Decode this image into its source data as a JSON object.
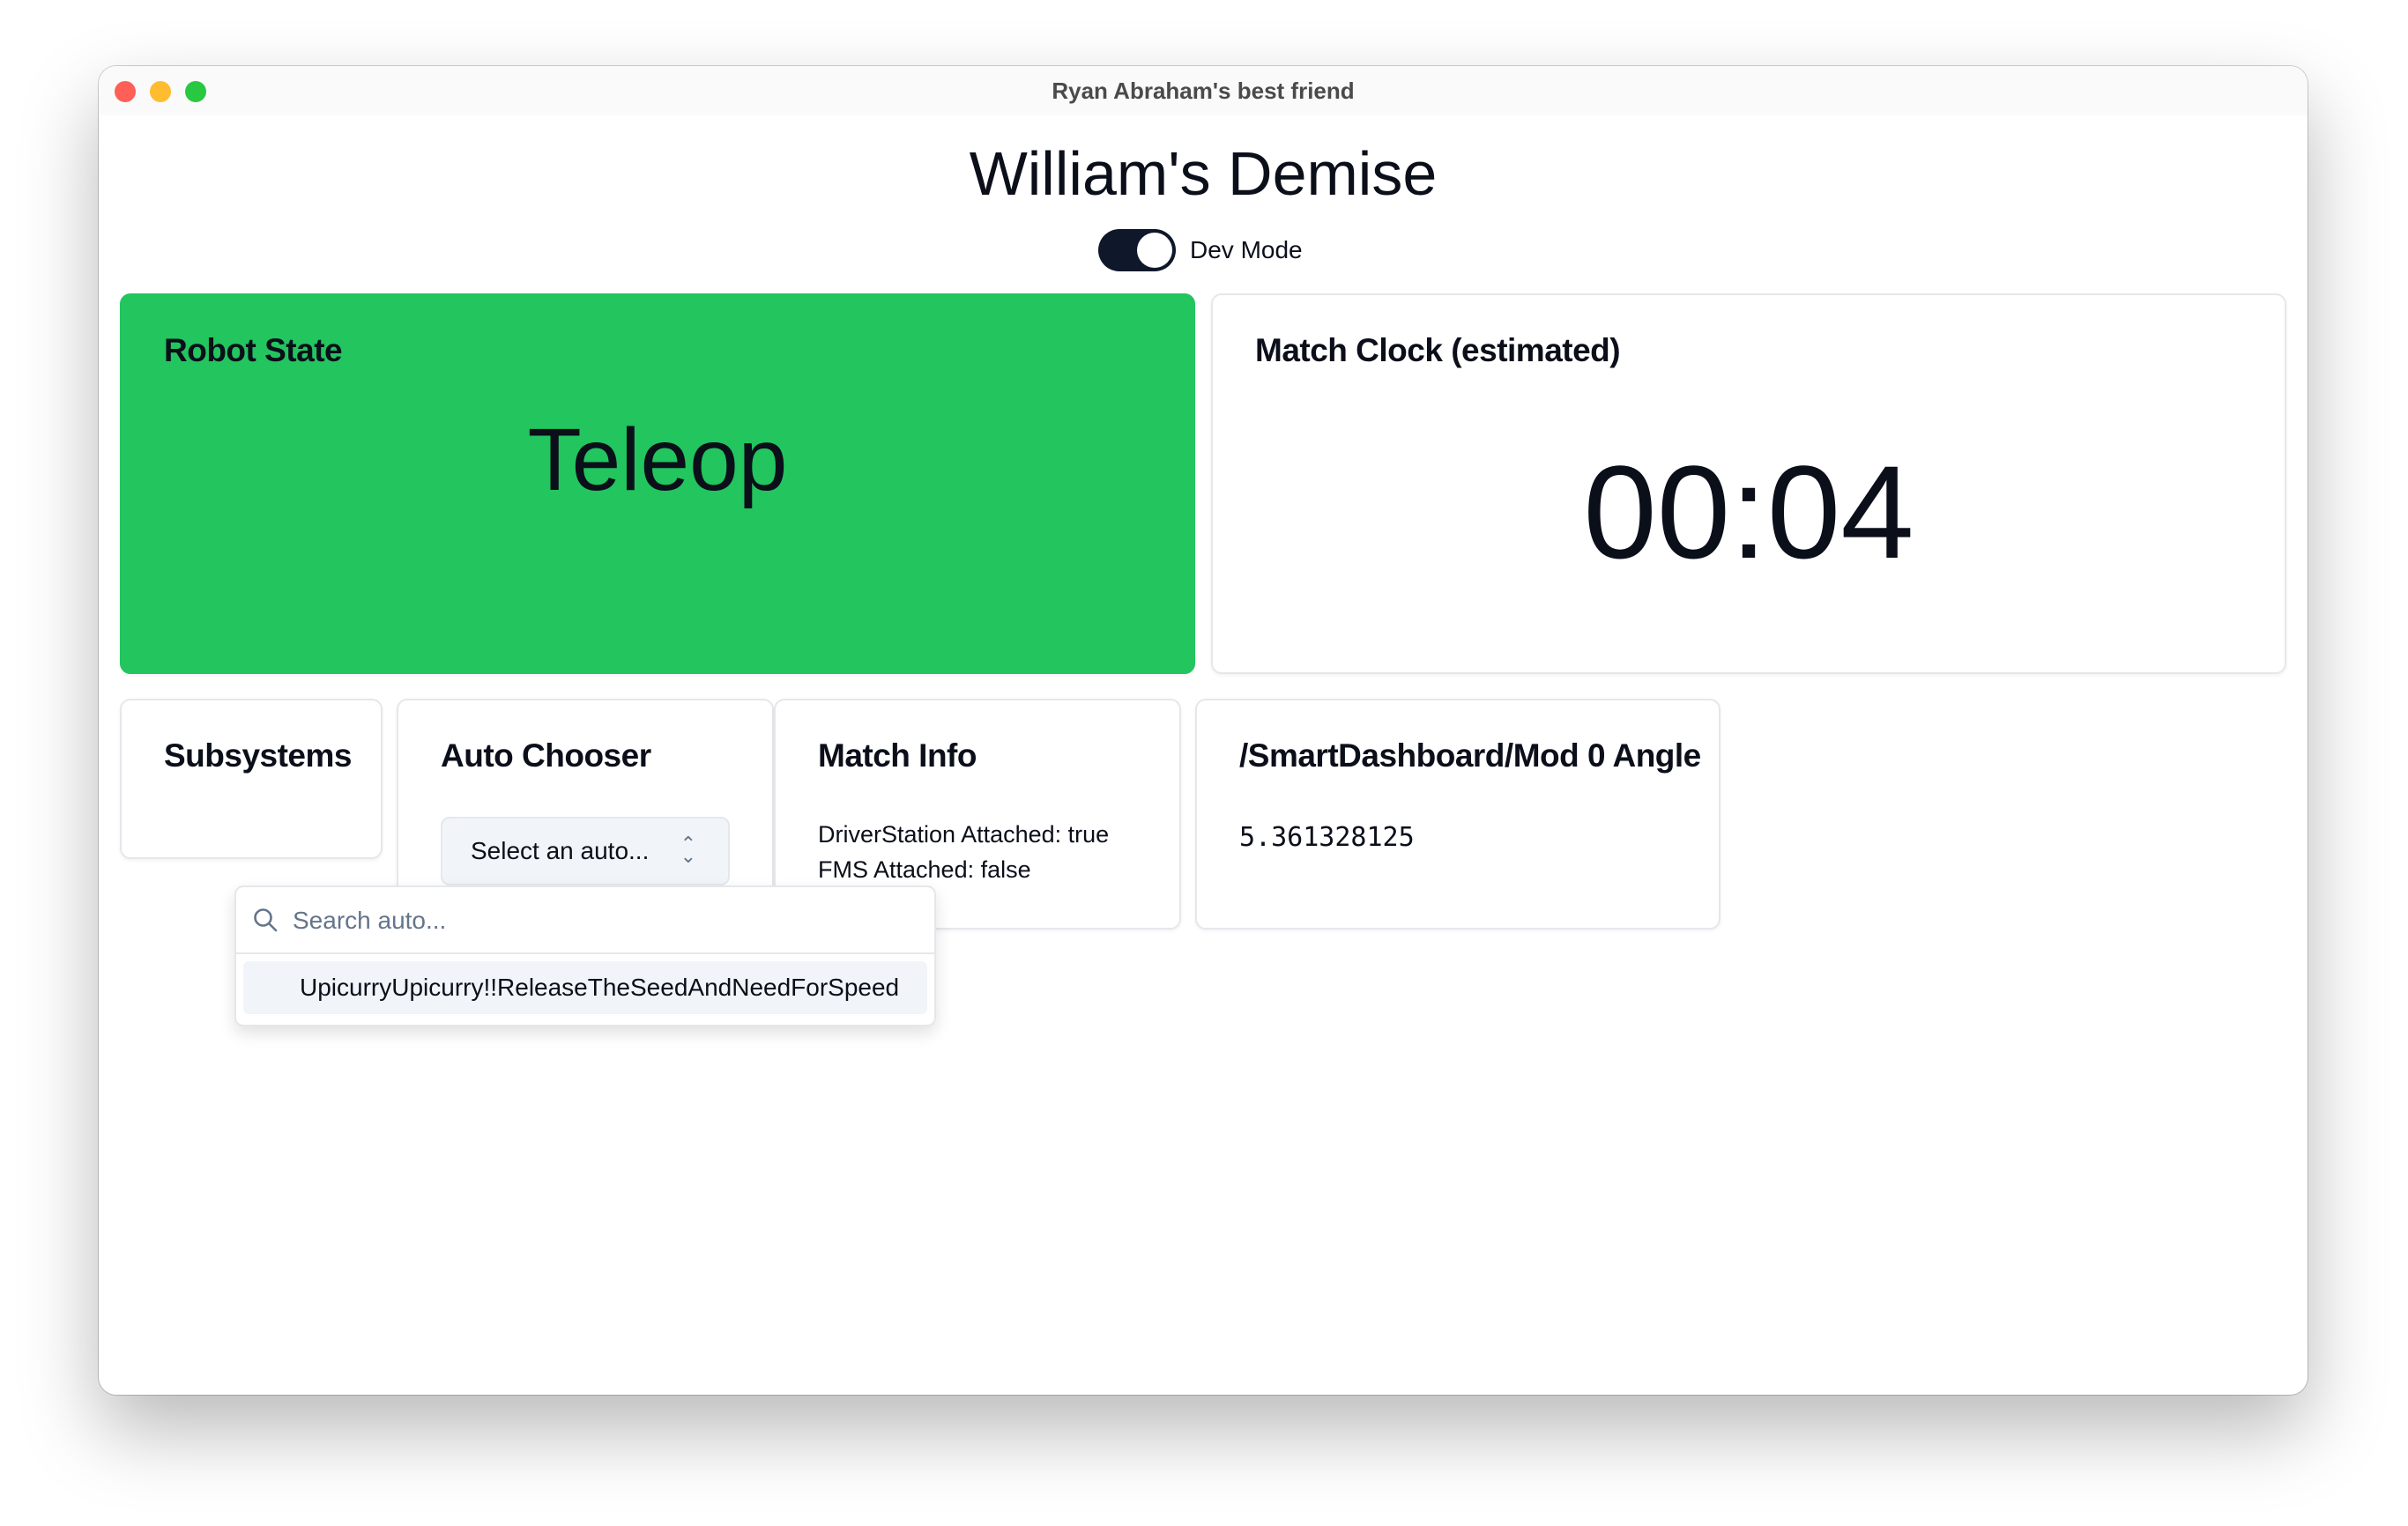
{
  "window": {
    "title": "Ryan Abraham's best friend"
  },
  "header": {
    "title": "William's Demise",
    "dev_mode_label": "Dev Mode",
    "dev_mode_on": true
  },
  "robot_state": {
    "title": "Robot State",
    "value": "Teleop",
    "color": "#22c55e"
  },
  "match_clock": {
    "title": "Match Clock (estimated)",
    "value": "00:04"
  },
  "subsystems": {
    "title": "Subsystems"
  },
  "auto_chooser": {
    "title": "Auto Chooser",
    "select_label": "Select an auto...",
    "search_placeholder": "Search auto...",
    "options": [
      "UpicurryUpicurry!!ReleaseTheSeedAndNeedForSpeed"
    ]
  },
  "match_info": {
    "title": "Match Info",
    "lines": [
      "DriverStation Attached: true",
      "FMS Attached: false"
    ]
  },
  "mod_angle": {
    "title": "/SmartDashboard/Mod 0 Angle",
    "value": "5.361328125"
  },
  "icons": [
    "search-icon",
    "chevron-up-down-icon"
  ]
}
